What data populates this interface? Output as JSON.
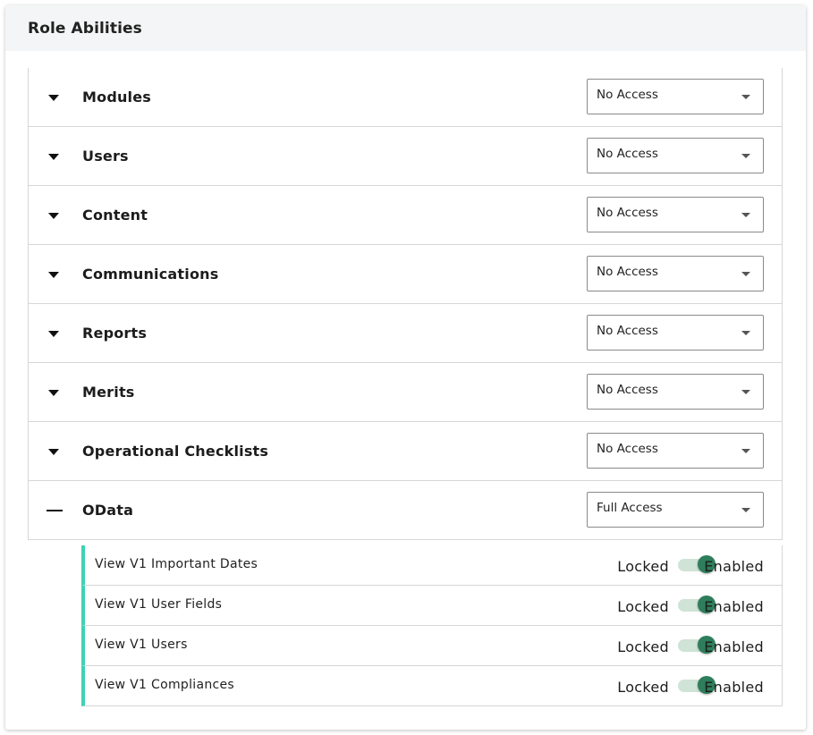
{
  "header": {
    "title": "Role Abilities"
  },
  "sections": [
    {
      "label": "Modules",
      "access": "No Access",
      "expanded": false
    },
    {
      "label": "Users",
      "access": "No Access",
      "expanded": false
    },
    {
      "label": "Content",
      "access": "No Access",
      "expanded": false
    },
    {
      "label": "Communications",
      "access": "No Access",
      "expanded": false
    },
    {
      "label": "Reports",
      "access": "No Access",
      "expanded": false
    },
    {
      "label": "Merits",
      "access": "No Access",
      "expanded": false
    },
    {
      "label": "Operational Checklists",
      "access": "No Access",
      "expanded": false
    },
    {
      "label": "OData",
      "access": "Full Access",
      "expanded": true
    }
  ],
  "odata_abilities": [
    {
      "label": "View V1 Important Dates",
      "off_label": "Locked",
      "on_label": "Enabled",
      "enabled": true
    },
    {
      "label": "View V1 User Fields",
      "off_label": "Locked",
      "on_label": "Enabled",
      "enabled": true
    },
    {
      "label": "View V1 Users",
      "off_label": "Locked",
      "on_label": "Enabled",
      "enabled": true
    },
    {
      "label": "View V1 Compliances",
      "off_label": "Locked",
      "on_label": "Enabled",
      "enabled": true
    }
  ],
  "colors": {
    "accent_bar": "#3dd2b4",
    "switch_knob": "#2e7d5b",
    "switch_track": "#cfe3d6",
    "header_bg": "#f4f5f6"
  },
  "icons": {
    "collapsed": "caret-down-icon",
    "expanded": "minus-icon",
    "select": "chevron-down-icon"
  }
}
